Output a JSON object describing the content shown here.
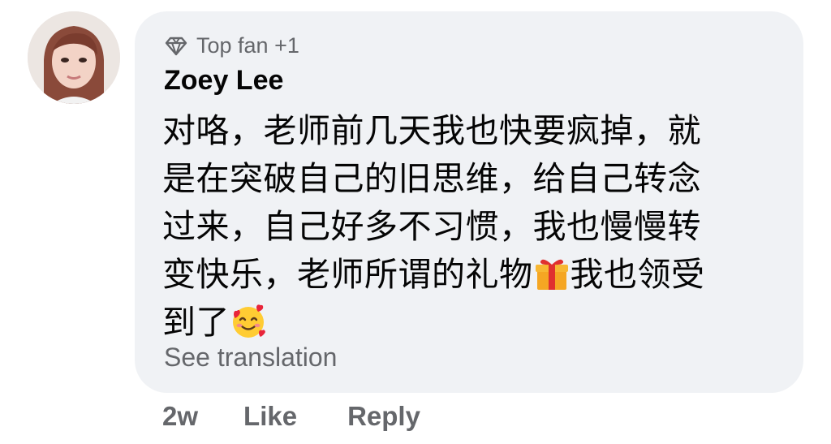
{
  "comment": {
    "badge": {
      "icon": "diamond-icon",
      "label": "Top fan +1"
    },
    "author": "Zoey Lee",
    "text": {
      "line1": "对咯，老师前几天我也快要疯掉，就",
      "line2": "是在突破自己的旧思维，给自己转念",
      "line3": "过来，自己好多不习惯，我也慢慢转",
      "line4_part1": "变快乐，老师所谓的礼物",
      "line4_emoji": "wrapped-gift-emoji",
      "line4_part2": "我也领受",
      "line5_part1": "到了",
      "line5_emoji": "smiling-face-with-hearts-emoji"
    },
    "see_translation": "See translation",
    "actions": {
      "time": "2w",
      "like": "Like",
      "reply": "Reply"
    }
  },
  "colors": {
    "bubble_bg": "#f0f2f5",
    "secondary_text": "#65676b",
    "primary_text": "#050505"
  }
}
